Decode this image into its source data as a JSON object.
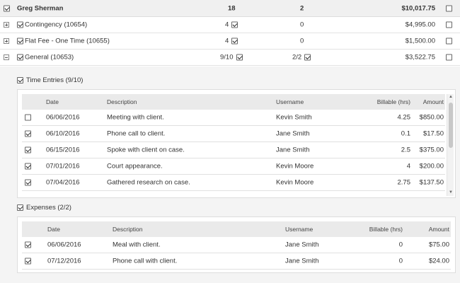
{
  "client": {
    "name": "Greg Sherman",
    "count": "18",
    "count2": "2",
    "amount": "$10,017.75"
  },
  "matters": [
    {
      "label": "Contingency (10654)",
      "time": "4",
      "expenses": "0",
      "amount": "$4,995.00",
      "expanded": false
    },
    {
      "label": "Flat Fee - One Time (10655)",
      "time": "4",
      "expenses": "0",
      "amount": "$1,500.00",
      "expanded": false
    },
    {
      "label": "General (10653)",
      "time": "9/10",
      "expenses": "2/2",
      "amount": "$3,522.75",
      "expanded": true
    }
  ],
  "time_entries": {
    "title": "Time Entries (9/10)",
    "columns": {
      "date": "Date",
      "description": "Description",
      "username": "Username",
      "billable": "Billable (hrs)",
      "amount": "Amount"
    },
    "rows": [
      {
        "checked": false,
        "date": "06/06/2016",
        "description": "Meeting with client.",
        "username": "Kevin Smith",
        "billable": "4.25",
        "amount": "$850.00"
      },
      {
        "checked": true,
        "date": "06/10/2016",
        "description": "Phone call to client.",
        "username": "Jane Smith",
        "billable": "0.1",
        "amount": "$17.50"
      },
      {
        "checked": true,
        "date": "06/15/2016",
        "description": "Spoke with client on case.",
        "username": "Jane Smith",
        "billable": "2.5",
        "amount": "$375.00"
      },
      {
        "checked": true,
        "date": "07/01/2016",
        "description": "Court appearance.",
        "username": "Kevin Moore",
        "billable": "4",
        "amount": "$200.00"
      },
      {
        "checked": true,
        "date": "07/04/2016",
        "description": "Gathered research on case.",
        "username": "Kevin Moore",
        "billable": "2.75",
        "amount": "$137.50"
      }
    ]
  },
  "expenses": {
    "title": "Expenses (2/2)",
    "columns": {
      "date": "Date",
      "description": "Description",
      "username": "Username",
      "billable": "Billable (hrs)",
      "amount": "Amount"
    },
    "rows": [
      {
        "checked": true,
        "date": "06/06/2016",
        "description": "Meal with client.",
        "username": "Jane Smith",
        "billable": "0",
        "amount": "$75.00"
      },
      {
        "checked": true,
        "date": "07/12/2016",
        "description": "Phone call with client.",
        "username": "Jane Smith",
        "billable": "0",
        "amount": "$24.00"
      }
    ]
  }
}
